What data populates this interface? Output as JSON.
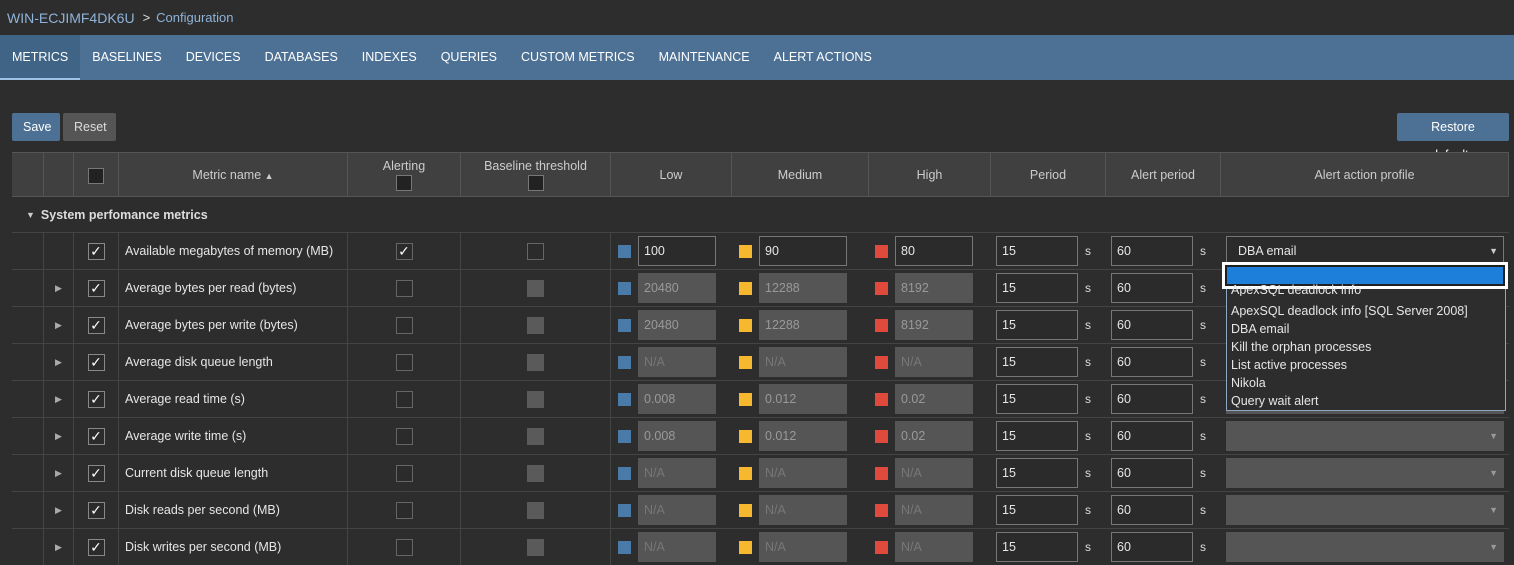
{
  "titlebar": {
    "host": "WIN-ECJIMF4DK6U",
    "crumb": "Configuration"
  },
  "tabs": [
    "METRICS",
    "BASELINES",
    "DEVICES",
    "DATABASES",
    "INDEXES",
    "QUERIES",
    "CUSTOM METRICS",
    "MAINTENANCE",
    "ALERT ACTIONS"
  ],
  "toolbar": {
    "save": "Save",
    "reset": "Reset",
    "restore": "Restore defaults"
  },
  "columns": {
    "metric_name": "Metric name",
    "alerting": "Alerting",
    "baseline": "Baseline threshold",
    "low": "Low",
    "medium": "Medium",
    "high": "High",
    "period": "Period",
    "alert_period": "Alert period",
    "profile": "Alert action profile"
  },
  "sort_indicator": "▲",
  "group": {
    "label": "System perfomance metrics"
  },
  "unit_s": "s",
  "colors": {
    "low": "#4a7aa8",
    "medium": "#f5b82e",
    "high": "#e04a3c",
    "accent": "#4d7194",
    "selection": "#1e7fdb"
  },
  "rows": [
    {
      "name": "Available megabytes of memory (MB)",
      "alerting": true,
      "low": "100",
      "medium": "90",
      "high": "80",
      "period": "15",
      "alert_period": "60",
      "profile": "DBA email",
      "thresholds_enabled": true
    },
    {
      "name": "Average bytes per read (bytes)",
      "alerting": false,
      "low": "20480",
      "medium": "12288",
      "high": "8192",
      "period": "15",
      "alert_period": "60",
      "profile": "",
      "thresholds_enabled": false
    },
    {
      "name": "Average bytes per write (bytes)",
      "alerting": false,
      "low": "20480",
      "medium": "12288",
      "high": "8192",
      "period": "15",
      "alert_period": "60",
      "profile": "",
      "thresholds_enabled": false
    },
    {
      "name": "Average disk queue length",
      "alerting": false,
      "low": "N/A",
      "medium": "N/A",
      "high": "N/A",
      "period": "15",
      "alert_period": "60",
      "profile": "",
      "thresholds_enabled": false
    },
    {
      "name": "Average read time (s)",
      "alerting": false,
      "low": "0.008",
      "medium": "0.012",
      "high": "0.02",
      "period": "15",
      "alert_period": "60",
      "profile": "",
      "thresholds_enabled": false
    },
    {
      "name": "Average write time (s)",
      "alerting": false,
      "low": "0.008",
      "medium": "0.012",
      "high": "0.02",
      "period": "15",
      "alert_period": "60",
      "profile": "",
      "thresholds_enabled": false
    },
    {
      "name": "Current disk queue length",
      "alerting": false,
      "low": "N/A",
      "medium": "N/A",
      "high": "N/A",
      "period": "15",
      "alert_period": "60",
      "profile": "",
      "thresholds_enabled": false
    },
    {
      "name": "Disk reads per second (MB)",
      "alerting": false,
      "low": "N/A",
      "medium": "N/A",
      "high": "N/A",
      "period": "15",
      "alert_period": "60",
      "profile": "",
      "thresholds_enabled": false
    },
    {
      "name": "Disk writes per second (MB)",
      "alerting": false,
      "low": "N/A",
      "medium": "N/A",
      "high": "N/A",
      "period": "15",
      "alert_period": "60",
      "profile": "",
      "thresholds_enabled": false
    }
  ],
  "dropdown": {
    "options": [
      "ApexSQL deadlock info",
      "ApexSQL deadlock info [SQL Server 2008]",
      "DBA email",
      "Kill the orphan processes",
      "List active processes",
      "Nikola",
      "Query wait alert"
    ]
  }
}
